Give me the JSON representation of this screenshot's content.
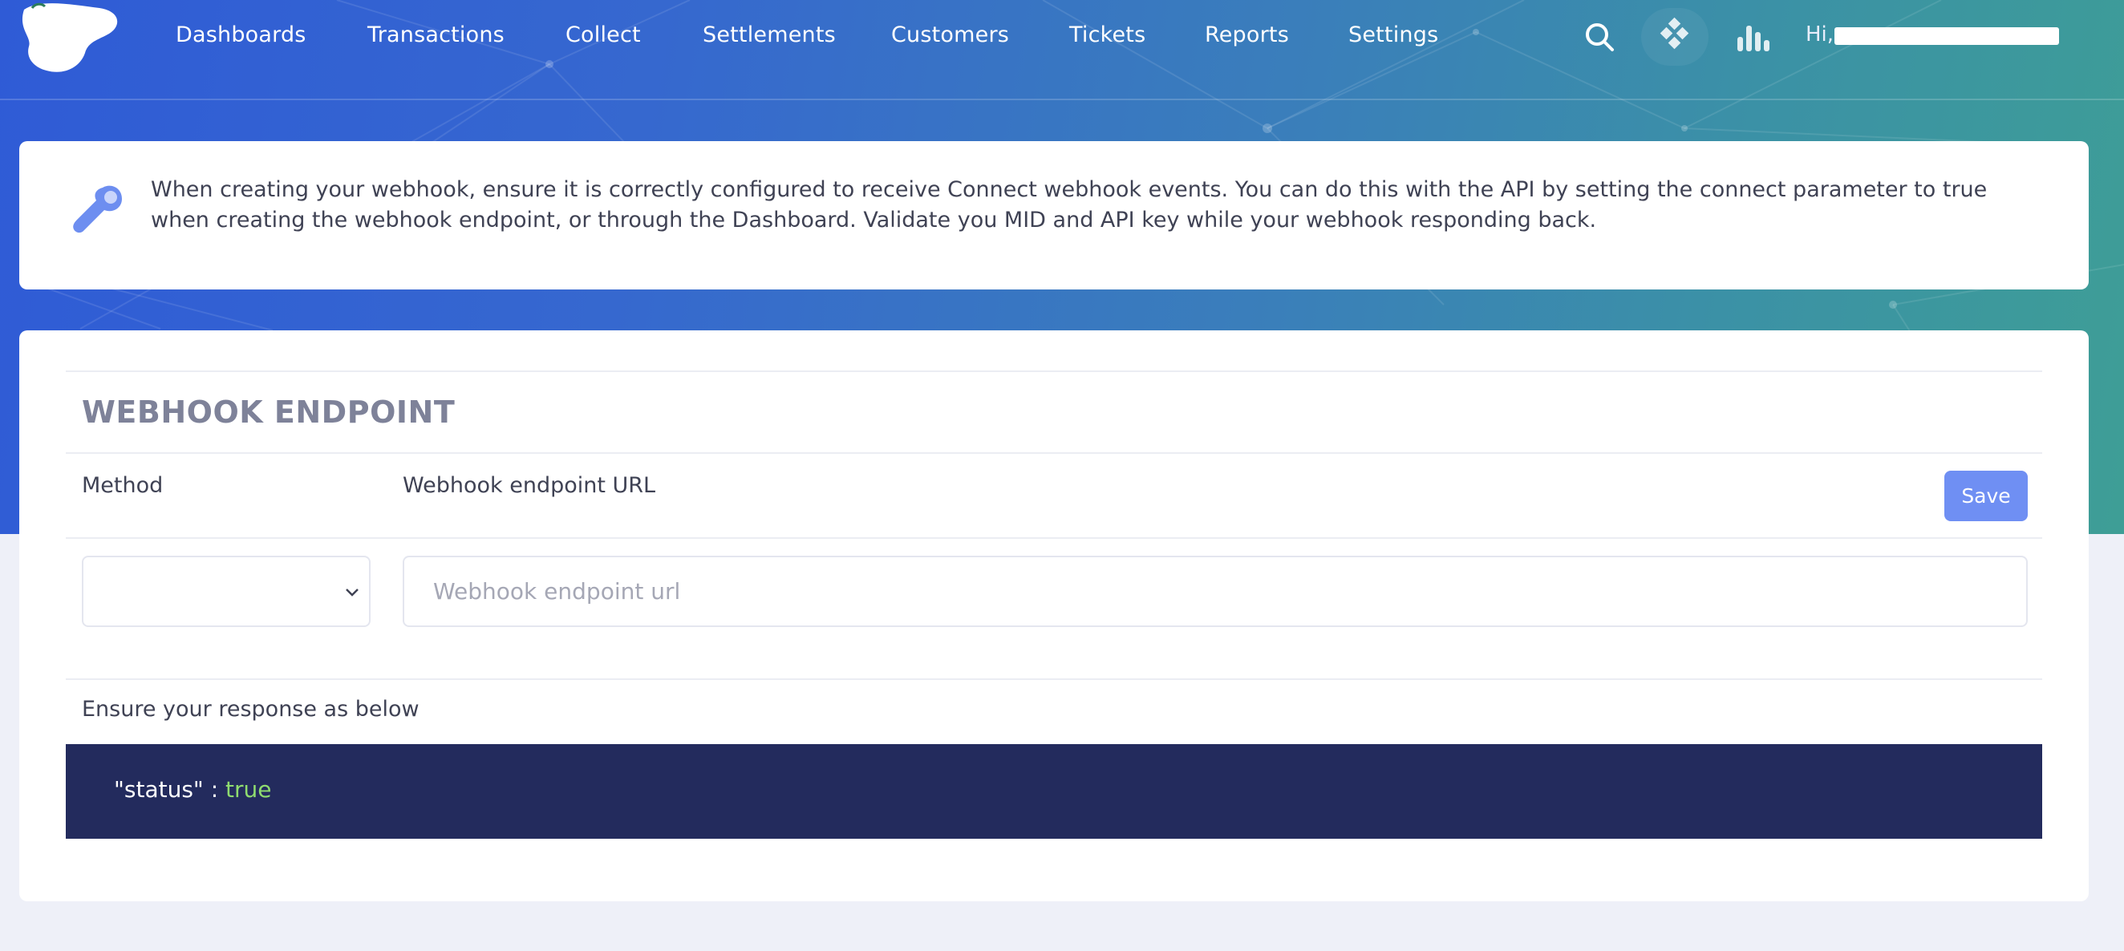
{
  "nav": {
    "items": [
      "Dashboards",
      "Transactions",
      "Collect",
      "Settlements",
      "Customers",
      "Tickets",
      "Reports",
      "Settings"
    ],
    "greeting_prefix": "Hi,"
  },
  "icons": {
    "search": "search-icon",
    "apps": "diamond-grid-icon",
    "stats": "bar-chart-icon",
    "notice": "wrench-icon",
    "select": "chevron-down-icon"
  },
  "notice": {
    "text": "When creating your webhook, ensure it is correctly configured to receive Connect webhook events. You can do this with the API by setting the connect parameter to true when creating the webhook endpoint, or through the Dashboard. Validate you MID and API key while your webhook responding back."
  },
  "webhook": {
    "title": "WEBHOOK ENDPOINT",
    "method_label": "Method",
    "url_label": "Webhook endpoint URL",
    "save_label": "Save",
    "method_value": "",
    "url_value": "",
    "url_placeholder": "Webhook endpoint url",
    "response_label": "Ensure your response as below",
    "code_key": "\"status\" : ",
    "code_value": "true"
  },
  "colors": {
    "accent": "#6f8ff3",
    "code_bg": "#232b5d",
    "code_value": "#8fdc6f",
    "header_start": "#2f5bd6",
    "header_end": "#3e9e96"
  }
}
